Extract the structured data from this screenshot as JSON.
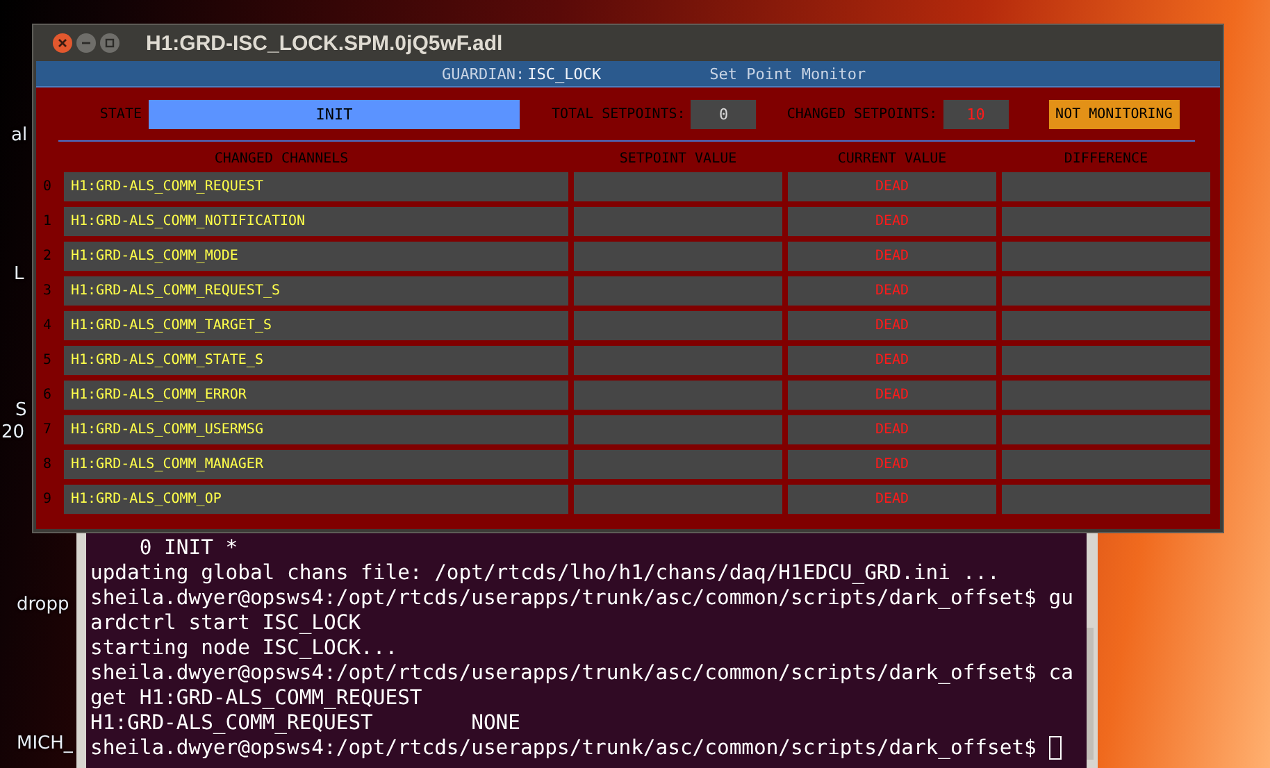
{
  "desktop": {
    "icon_labels": [
      "al",
      "L",
      "S",
      "20",
      "dropp",
      "MICH_"
    ]
  },
  "medm_window": {
    "title": "H1:GRD-ISC_LOCK.SPM.0jQ5wF.adl",
    "header": {
      "guardian_label": "GUARDIAN:",
      "guardian_value": "ISC_LOCK",
      "subtitle": "Set Point Monitor"
    },
    "state": {
      "label": "STATE",
      "value": "INIT"
    },
    "total_setpoints": {
      "label": "TOTAL SETPOINTS:",
      "value": "0"
    },
    "changed_setpoints": {
      "label": "CHANGED SETPOINTS:",
      "value": "10"
    },
    "monitoring_status": "NOT MONITORING",
    "table": {
      "columns": [
        "CHANGED CHANNELS",
        "SETPOINT VALUE",
        "CURRENT VALUE",
        "DIFFERENCE"
      ],
      "rows": [
        {
          "index": "0",
          "channel": "H1:GRD-ALS_COMM_REQUEST",
          "current_value": "DEAD"
        },
        {
          "index": "1",
          "channel": "H1:GRD-ALS_COMM_NOTIFICATION",
          "current_value": "DEAD"
        },
        {
          "index": "2",
          "channel": "H1:GRD-ALS_COMM_MODE",
          "current_value": "DEAD"
        },
        {
          "index": "3",
          "channel": "H1:GRD-ALS_COMM_REQUEST_S",
          "current_value": "DEAD"
        },
        {
          "index": "4",
          "channel": "H1:GRD-ALS_COMM_TARGET_S",
          "current_value": "DEAD"
        },
        {
          "index": "5",
          "channel": "H1:GRD-ALS_COMM_STATE_S",
          "current_value": "DEAD"
        },
        {
          "index": "6",
          "channel": "H1:GRD-ALS_COMM_ERROR",
          "current_value": "DEAD"
        },
        {
          "index": "7",
          "channel": "H1:GRD-ALS_COMM_USERMSG",
          "current_value": "DEAD"
        },
        {
          "index": "8",
          "channel": "H1:GRD-ALS_COMM_MANAGER",
          "current_value": "DEAD"
        },
        {
          "index": "9",
          "channel": "H1:GRD-ALS_COMM_OP",
          "current_value": "DEAD"
        }
      ]
    }
  },
  "terminal": {
    "lines": [
      "    0 INIT *",
      "updating global chans file: /opt/rtcds/lho/h1/chans/daq/H1EDCU_GRD.ini ...",
      "sheila.dwyer@opsws4:/opt/rtcds/userapps/trunk/asc/common/scripts/dark_offset$ gu",
      "ardctrl start ISC_LOCK",
      "starting node ISC_LOCK...",
      "sheila.dwyer@opsws4:/opt/rtcds/userapps/trunk/asc/common/scripts/dark_offset$ ca",
      "get H1:GRD-ALS_COMM_REQUEST",
      "H1:GRD-ALS_COMM_REQUEST        NONE",
      "sheila.dwyer@opsws4:/opt/rtcds/userapps/trunk/asc/common/scripts/dark_offset$ "
    ]
  }
}
